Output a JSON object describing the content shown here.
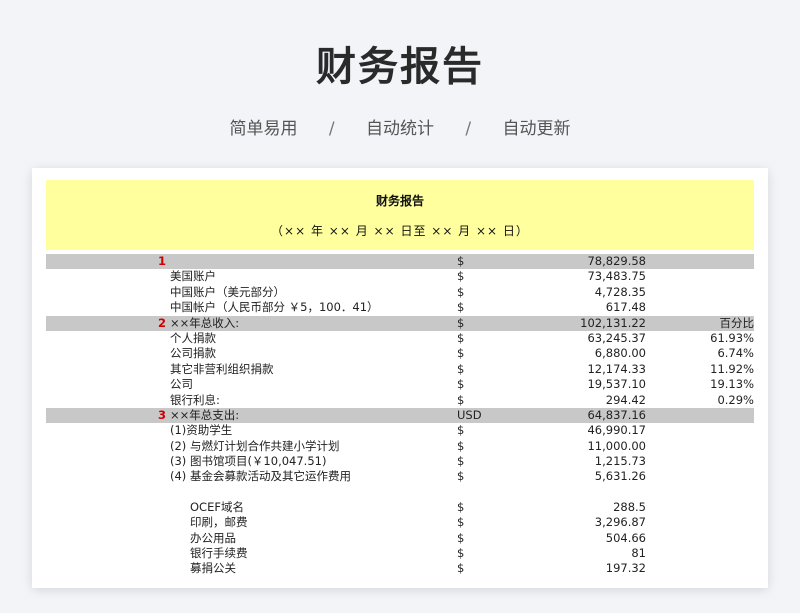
{
  "page": {
    "title": "财务报告",
    "features": [
      "简单易用",
      "自动统计",
      "自动更新"
    ],
    "separator": "/"
  },
  "report": {
    "title": "财务报告",
    "date_range": "（×× 年 ×× 月 ×× 日至 ×× 月 ×× 日）",
    "rows": [
      {
        "type": "section",
        "num": "1",
        "label": "",
        "cur": "$",
        "amt": "78,829.58",
        "pct": ""
      },
      {
        "type": "item",
        "label": "美国账户",
        "cur": "$",
        "amt": "73,483.75",
        "pct": ""
      },
      {
        "type": "item",
        "label": "中国账户（美元部分）",
        "cur": "$",
        "amt": "4,728.35",
        "pct": ""
      },
      {
        "type": "item",
        "label": "中国帐户（人民币部分 ￥5，100．41）",
        "cur": "$",
        "amt": "617.48",
        "pct": ""
      },
      {
        "type": "section",
        "num": "2",
        "label": "××年总收入:",
        "cur": "$",
        "amt": "102,131.22",
        "pct": "百分比"
      },
      {
        "type": "item",
        "label": "个人捐款",
        "cur": "$",
        "amt": "63,245.37",
        "pct": "61.93%"
      },
      {
        "type": "item",
        "label": "公司捐款",
        "cur": "$",
        "amt": "6,880.00",
        "pct": "6.74%"
      },
      {
        "type": "item",
        "label": "其它非营利组织捐款",
        "cur": "$",
        "amt": "12,174.33",
        "pct": "11.92%"
      },
      {
        "type": "item",
        "label": "公司",
        "cur": "$",
        "amt": "19,537.10",
        "pct": "19.13%"
      },
      {
        "type": "item",
        "label": "银行利息:",
        "cur": "$",
        "amt": "294.42",
        "pct": "0.29%"
      },
      {
        "type": "section",
        "num": "3",
        "label": "××年总支出:",
        "cur": "USD",
        "amt": "64,837.16",
        "pct": ""
      },
      {
        "type": "item",
        "label": "(1)资助学生",
        "cur": "$",
        "amt": "46,990.17",
        "pct": ""
      },
      {
        "type": "item",
        "label": "(2) 与燃灯计划合作共建小学计划",
        "cur": "$",
        "amt": "11,000.00",
        "pct": ""
      },
      {
        "type": "item",
        "label": "(3) 图书馆项目(￥10,047.51)",
        "cur": "$",
        "amt": "1,215.73",
        "pct": ""
      },
      {
        "type": "item",
        "label": "(4) 基金会募款活动及其它运作费用",
        "cur": "$",
        "amt": "5,631.26",
        "pct": ""
      },
      {
        "type": "gap"
      },
      {
        "type": "sub",
        "label": "OCEF域名",
        "cur": "$",
        "amt": "288.5",
        "pct": ""
      },
      {
        "type": "sub",
        "label": "印刷，邮费",
        "cur": "$",
        "amt": "3,296.87",
        "pct": ""
      },
      {
        "type": "sub",
        "label": "办公用品",
        "cur": "$",
        "amt": "504.66",
        "pct": ""
      },
      {
        "type": "sub",
        "label": "银行手续费",
        "cur": "$",
        "amt": "81",
        "pct": ""
      },
      {
        "type": "sub",
        "label": "募捐公关",
        "cur": "$",
        "amt": "197.32",
        "pct": ""
      }
    ]
  }
}
